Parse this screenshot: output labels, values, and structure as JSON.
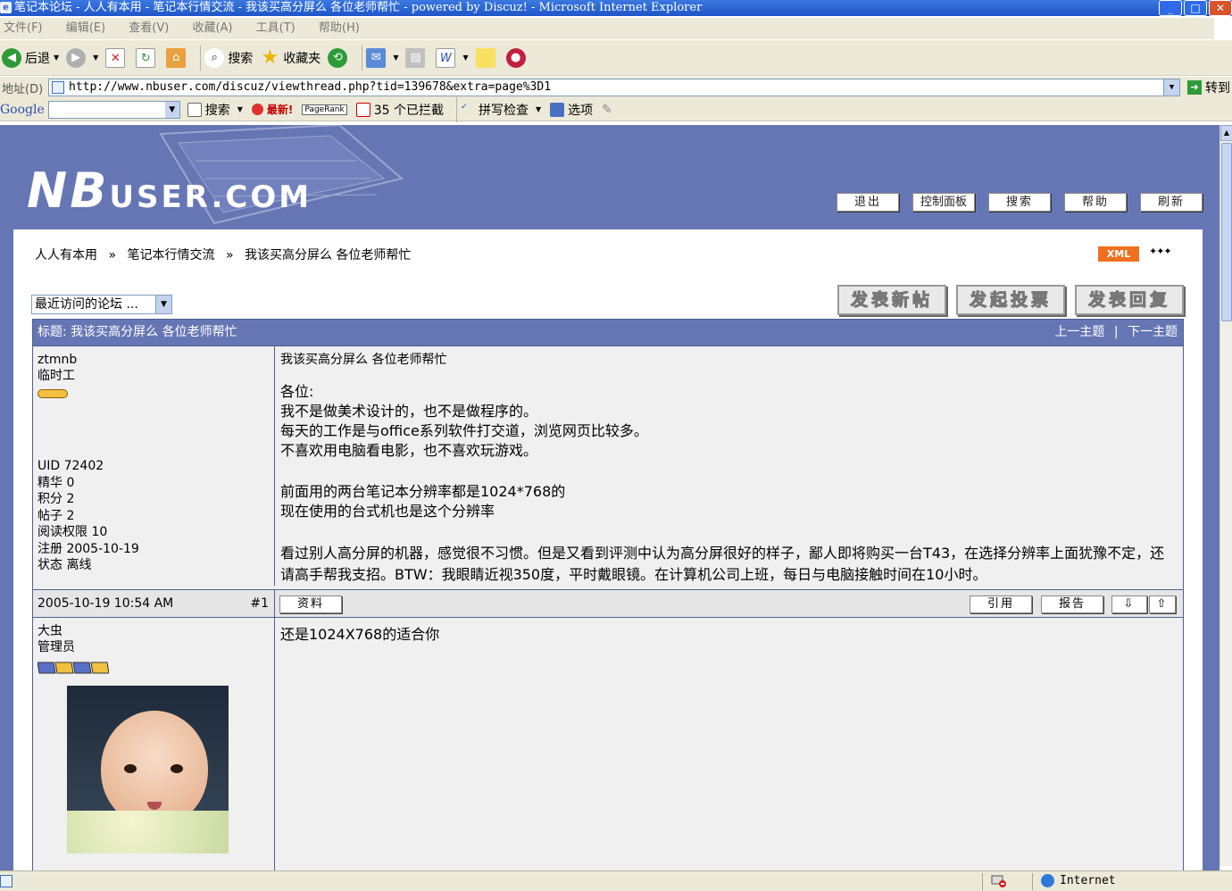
{
  "window": {
    "title": "笔记本论坛 - 人人有本用 - 笔记本行情交流 - 我该买高分屏么 各位老师帮忙 - powered by Discuz! - Microsoft Internet Explorer"
  },
  "menu": [
    "文件(F)",
    "编辑(E)",
    "查看(V)",
    "收藏(A)",
    "工具(T)",
    "帮助(H)"
  ],
  "toolbar": {
    "back_label": "后退",
    "search_label": "搜索",
    "favorites_label": "收藏夹"
  },
  "address": {
    "label": "地址(D)",
    "url": "http://www.nbuser.com/discuz/viewthread.php?tid=139678&extra=page%3D1",
    "go_label": "转到"
  },
  "googlebar": {
    "logo": "Google",
    "search_label": "搜索",
    "latest_label": "最新!",
    "pagerank_label": "PageRank",
    "blocked_label": "35 个已拦截",
    "spellcheck_label": "拼写检查",
    "options_label": "选项"
  },
  "site": {
    "logo_big": "NB",
    "logo_small": "USER.COM",
    "nav": [
      "退出",
      "控制面板",
      "搜索",
      "帮助",
      "刷新"
    ]
  },
  "breadcrumb": [
    "人人有本用",
    "笔记本行情交流",
    "我该买高分屏么 各位老师帮忙"
  ],
  "breadcrumb_sep": "»",
  "xml_badge": "XML",
  "forum_select": "最近访问的论坛 ...",
  "action_buttons": [
    "发表新帖",
    "发起投票",
    "发表回复"
  ],
  "thread": {
    "title_label": "标题: 我该买高分屏么 各位老师帮忙",
    "prev": "上一主题",
    "next": "下一主题",
    "pn_sep": "|"
  },
  "post1": {
    "author": "ztmnb",
    "rank": "临时工",
    "stats": [
      "UID 72402",
      "精华 0",
      "积分 2",
      "帖子 2",
      "阅读权限 10",
      "注册 2005-10-19",
      "状态 离线"
    ],
    "title": "我该买高分屏么 各位老师帮忙",
    "para1": [
      "各位:",
      "我不是做美术设计的，也不是做程序的。",
      "每天的工作是与office系列软件打交道，浏览网页比较多。",
      "不喜欢用电脑看电影，也不喜欢玩游戏。"
    ],
    "para2": [
      "前面用的两台笔记本分辨率都是1024*768的",
      "现在使用的台式机也是这个分辨率"
    ],
    "para3": "看过别人高分屏的机器，感觉很不习惯。但是又看到评测中认为高分屏很好的样子，鄙人即将购买一台T43，在选择分辨率上面犹豫不定，还请高手帮我支招。BTW：我眼睛近视350度，平时戴眼镜。在计算机公司上班，每日与电脑接触时间在10小时。",
    "date": "2005-10-19 10:54 AM",
    "floor": "#1",
    "profile_btn": "资料",
    "quote_btn": "引用",
    "report_btn": "报告"
  },
  "post2": {
    "author": "大虫",
    "rank": "管理员",
    "body": "还是1024X768的适合你"
  },
  "status": {
    "zone": "Internet"
  }
}
